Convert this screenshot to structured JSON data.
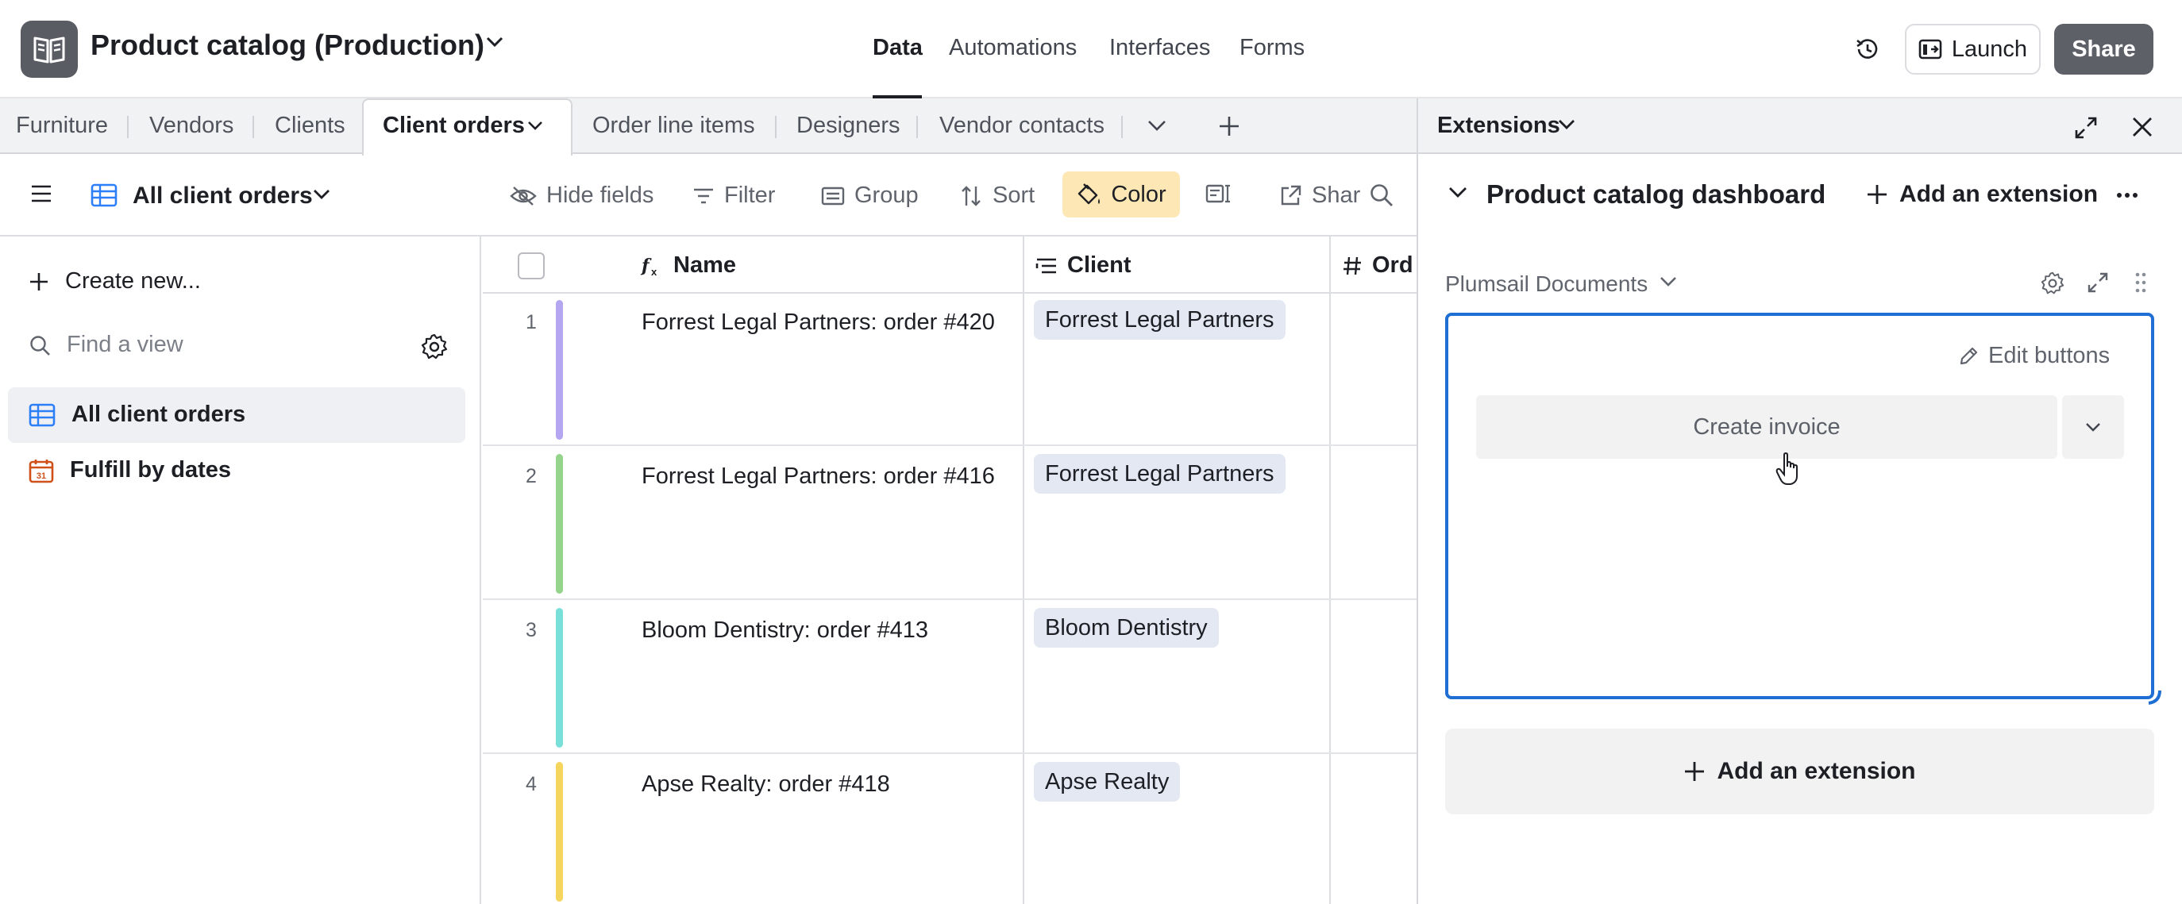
{
  "base": {
    "title": "Product catalog (Production)",
    "icon": "book-open-icon"
  },
  "nav": {
    "tabs": [
      "Data",
      "Automations",
      "Interfaces",
      "Forms"
    ],
    "active": "Data"
  },
  "header_actions": {
    "history_icon": "history-icon",
    "launch_label": "Launch",
    "share_label": "Share"
  },
  "table_tabs": {
    "items": [
      "Furniture",
      "Vendors",
      "Clients",
      "Client orders",
      "Order line items",
      "Designers",
      "Vendor contacts"
    ],
    "active": "Client orders"
  },
  "view": {
    "name": "All client orders"
  },
  "toolbar": {
    "hide_fields": "Hide fields",
    "filter": "Filter",
    "group": "Group",
    "sort": "Sort",
    "color": "Color",
    "share_partial": "Shar"
  },
  "sidebar": {
    "create_new": "Create new...",
    "find_placeholder": "Find a view",
    "views": [
      {
        "label": "All client orders",
        "icon": "grid-icon",
        "active": true
      },
      {
        "label": "Fulfill by dates",
        "icon": "calendar-icon",
        "active": false
      }
    ]
  },
  "grid": {
    "columns": [
      "Name",
      "Client",
      "Ord"
    ],
    "rows": [
      {
        "num": "1",
        "name": "Forrest Legal Partners: order #420",
        "client": "Forrest Legal Partners",
        "color": "#b4a6f0"
      },
      {
        "num": "2",
        "name": "Forrest Legal Partners: order #416",
        "client": "Forrest Legal Partners",
        "color": "#95d48b"
      },
      {
        "num": "3",
        "name": "Bloom Dentistry: order #413",
        "client": "Bloom Dentistry",
        "color": "#79e0d9"
      },
      {
        "num": "4",
        "name": "Apse Realty: order #418",
        "client": "Apse Realty",
        "color": "#f5d55e"
      }
    ]
  },
  "extensions": {
    "title": "Extensions",
    "dashboard_title": "Product catalog dashboard",
    "add_extension": "Add an extension",
    "extension_name": "Plumsail Documents",
    "edit_buttons": "Edit buttons",
    "create_invoice": "Create invoice",
    "accent_color": "#1f6ed4"
  }
}
